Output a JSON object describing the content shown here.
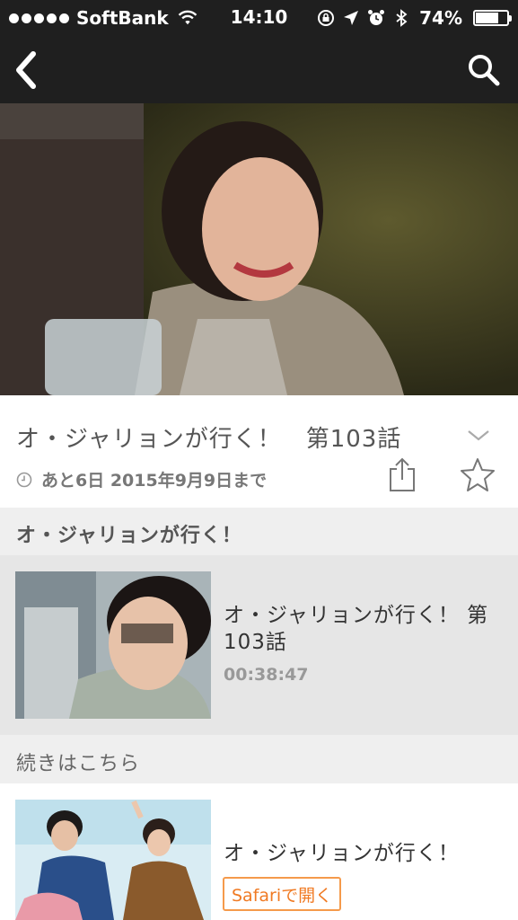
{
  "status_bar": {
    "carrier": "SoftBank",
    "time": "14:10",
    "battery_percent": "74%",
    "battery_level": 0.74
  },
  "nav": {
    "back_icon": "chevron-left-icon",
    "search_icon": "search-icon"
  },
  "episode_header": {
    "title": "オ・ジャリョンが行く！　第103話",
    "expiry": "あと6日 2015年9月9日まで"
  },
  "series_section": {
    "title": "オ・ジャリョンが行く！"
  },
  "episode_item": {
    "title": "オ・ジャリョンが行く！ 第103話",
    "duration": "00:38:47"
  },
  "continue_section": {
    "title": "続きはこちら"
  },
  "continue_item": {
    "title": "オ・ジャリョンが行く！",
    "button_label": "Safariで開く"
  },
  "colors": {
    "bar": "#1f1f1f",
    "accent": "#f07a23",
    "section_bg": "#efefef",
    "episode_bg": "#e6e6e6"
  }
}
